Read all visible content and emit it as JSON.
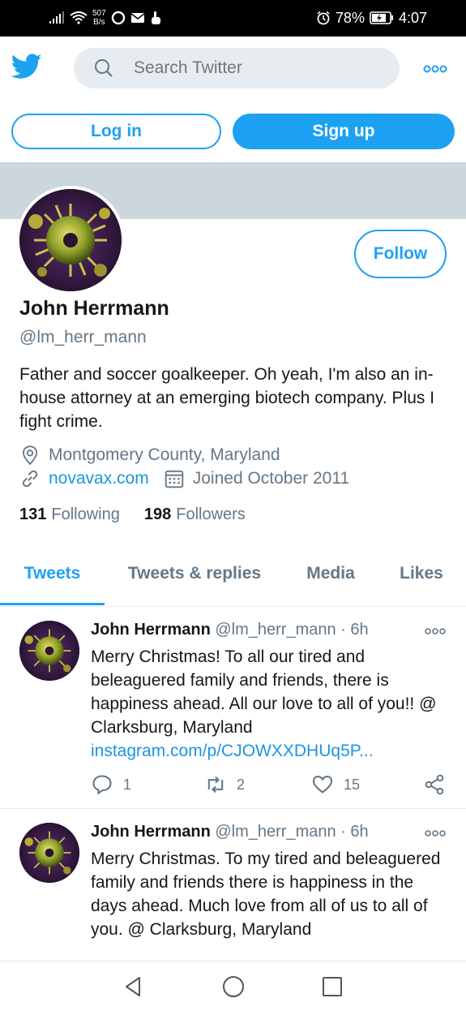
{
  "status_bar": {
    "speed_value": "507",
    "speed_unit": "B/s",
    "battery": "78%",
    "time": "4:07"
  },
  "header": {
    "search_placeholder": "Search Twitter",
    "login_label": "Log in",
    "signup_label": "Sign up"
  },
  "profile": {
    "follow_label": "Follow",
    "name": "John Herrmann",
    "handle": "@lm_herr_mann",
    "bio": "Father and soccer goalkeeper. Oh yeah, I'm also an in-house attorney at an emerging biotech company. Plus I fight crime.",
    "location": "Montgomery County, Maryland",
    "website": "novavax.com",
    "joined": "Joined October 2011",
    "following_count": "131",
    "following_label": "Following",
    "followers_count": "198",
    "followers_label": "Followers"
  },
  "tabs": [
    {
      "label": "Tweets",
      "active": true
    },
    {
      "label": "Tweets & replies",
      "active": false
    },
    {
      "label": "Media",
      "active": false
    },
    {
      "label": "Likes",
      "active": false
    }
  ],
  "tweets": [
    {
      "name": "John Herrmann",
      "handle": "@lm_herr_mann",
      "time": "· 6h",
      "text": "Merry Christmas! To all our tired and beleaguered family and friends, there is happiness ahead. All our love to all of you!! @ Clarksburg, Maryland",
      "link": "instagram.com/p/CJOWXXDHUq5P...",
      "replies": "1",
      "retweets": "2",
      "likes": "15"
    },
    {
      "name": "John Herrmann",
      "handle": "@lm_herr_mann",
      "time": "· 6h",
      "text": "Merry Christmas. To my tired and beleaguered family and friends there is happiness in the days ahead. Much love from all of us to all of you. @ Clarksburg, Maryland"
    }
  ],
  "colors": {
    "accent": "#1da1f2",
    "banner": "#ccd6dd",
    "secondary_text": "#657786"
  }
}
